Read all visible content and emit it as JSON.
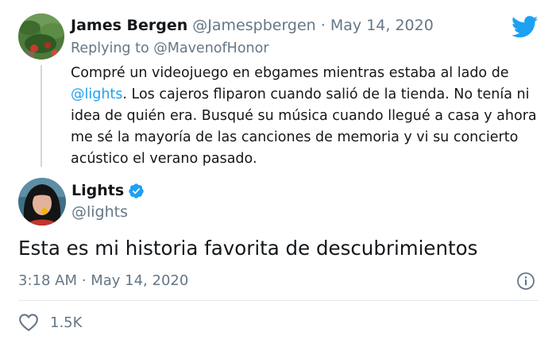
{
  "reply_tweet": {
    "author_name": "James Bergen",
    "author_handle": "@Jamespbergen",
    "separator": "·",
    "date": "May 14, 2020",
    "replying_to_label": "Replying to",
    "replying_to_handle": "@MavenofHonor",
    "text_before_mention": "Compré un videojuego en ebgames mientras estaba al lado de ",
    "mention": "@lights",
    "text_after_mention": ". Los cajeros fliparon cuando salió de la tienda. No tenía ni idea de quién era. Busqué su música cuando llegué a casa y ahora me sé la mayoría de las canciones de memoria y vi su concierto acústico el verano pasado."
  },
  "main_tweet": {
    "author_name": "Lights",
    "author_handle": "@lights",
    "text": "Esta es mi historia favorita de descubrimientos",
    "time": "3:18 AM",
    "separator": "·",
    "date": "May 14, 2020",
    "likes": "1.5K"
  },
  "icons": {
    "brand": "twitter-bird-icon",
    "verified": "verified-badge-icon",
    "info": "info-icon",
    "like": "heart-icon"
  },
  "colors": {
    "twitter_blue": "#1da1f2",
    "secondary_text": "#657786",
    "primary_text": "#14171a"
  }
}
